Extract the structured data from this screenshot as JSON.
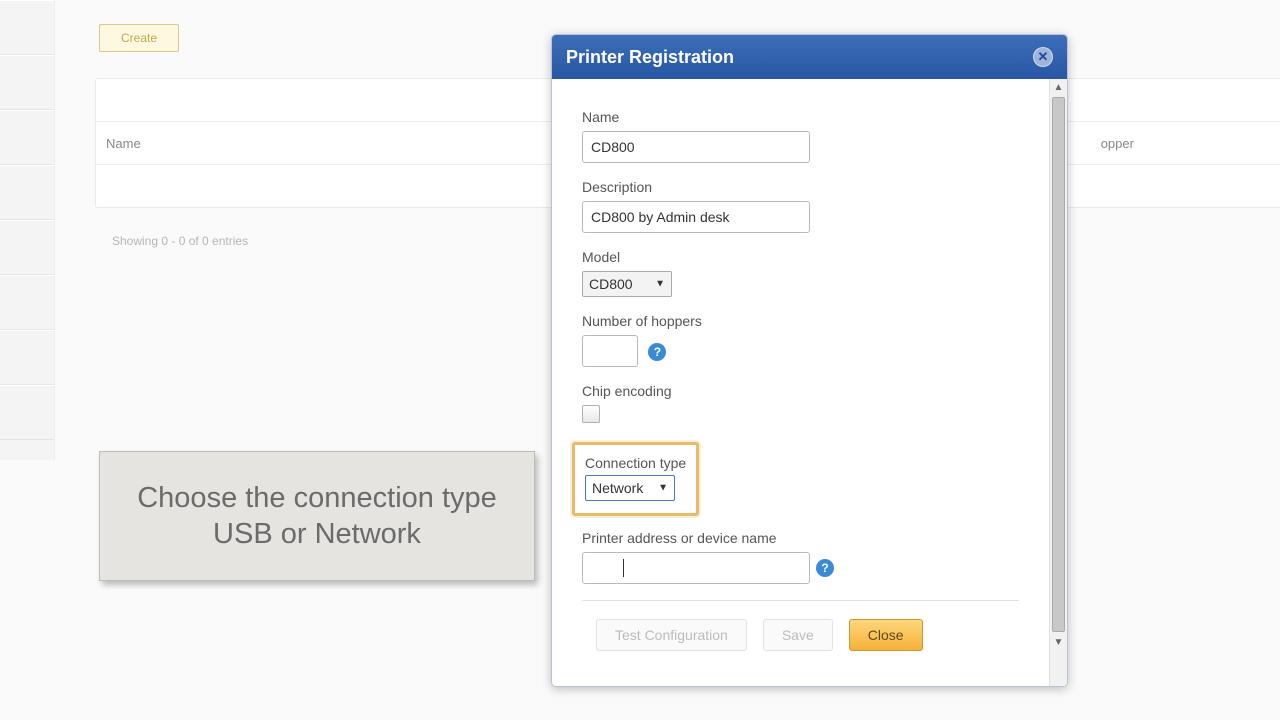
{
  "bg": {
    "create_label": "Create",
    "col_name": "Name",
    "col_hopper": "opper",
    "entries": "Showing 0 - 0 of 0 entries"
  },
  "callout": {
    "text": "Choose the connection type\nUSB or Network"
  },
  "dialog": {
    "title": "Printer Registration",
    "name_label": "Name",
    "name_value": "CD800",
    "desc_label": "Description",
    "desc_value": "CD800 by Admin desk",
    "model_label": "Model",
    "model_value": "CD800",
    "hoppers_label": "Number of hoppers",
    "hoppers_value": "",
    "chip_label": "Chip encoding",
    "conn_label": "Connection type",
    "conn_value": "Network",
    "addr_label": "Printer address or device name",
    "addr_value": "",
    "btn_test": "Test Configuration",
    "btn_save": "Save",
    "btn_close": "Close"
  }
}
